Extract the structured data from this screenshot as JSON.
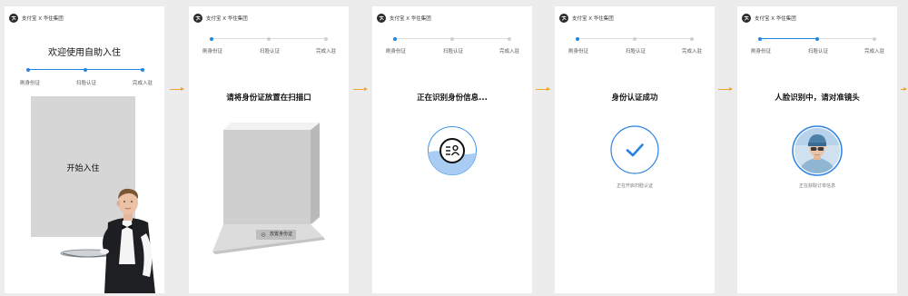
{
  "brand_text": "支付宝 X 华住集团",
  "steps": [
    "刷身份证",
    "扫脸认证",
    "完成入驻"
  ],
  "screens": [
    {
      "title": "欢迎使用自助入住",
      "button": "开始入住",
      "active_step": 3
    },
    {
      "title": "请将身份证放置在扫描口",
      "slot_label": "放置身份证",
      "active_step": 1
    },
    {
      "title": "正在识别身份信息...",
      "active_step": 1
    },
    {
      "title": "身份认证成功",
      "status": "正在开启扫脸认证",
      "active_step": 1
    },
    {
      "title": "人脸识别中，请对准镜头",
      "status": "正在获取订单信息",
      "active_step": 2
    }
  ],
  "colors": {
    "accent": "#1f86e6",
    "arrow": "#f0a32f",
    "panel": "#d6d6d6"
  }
}
